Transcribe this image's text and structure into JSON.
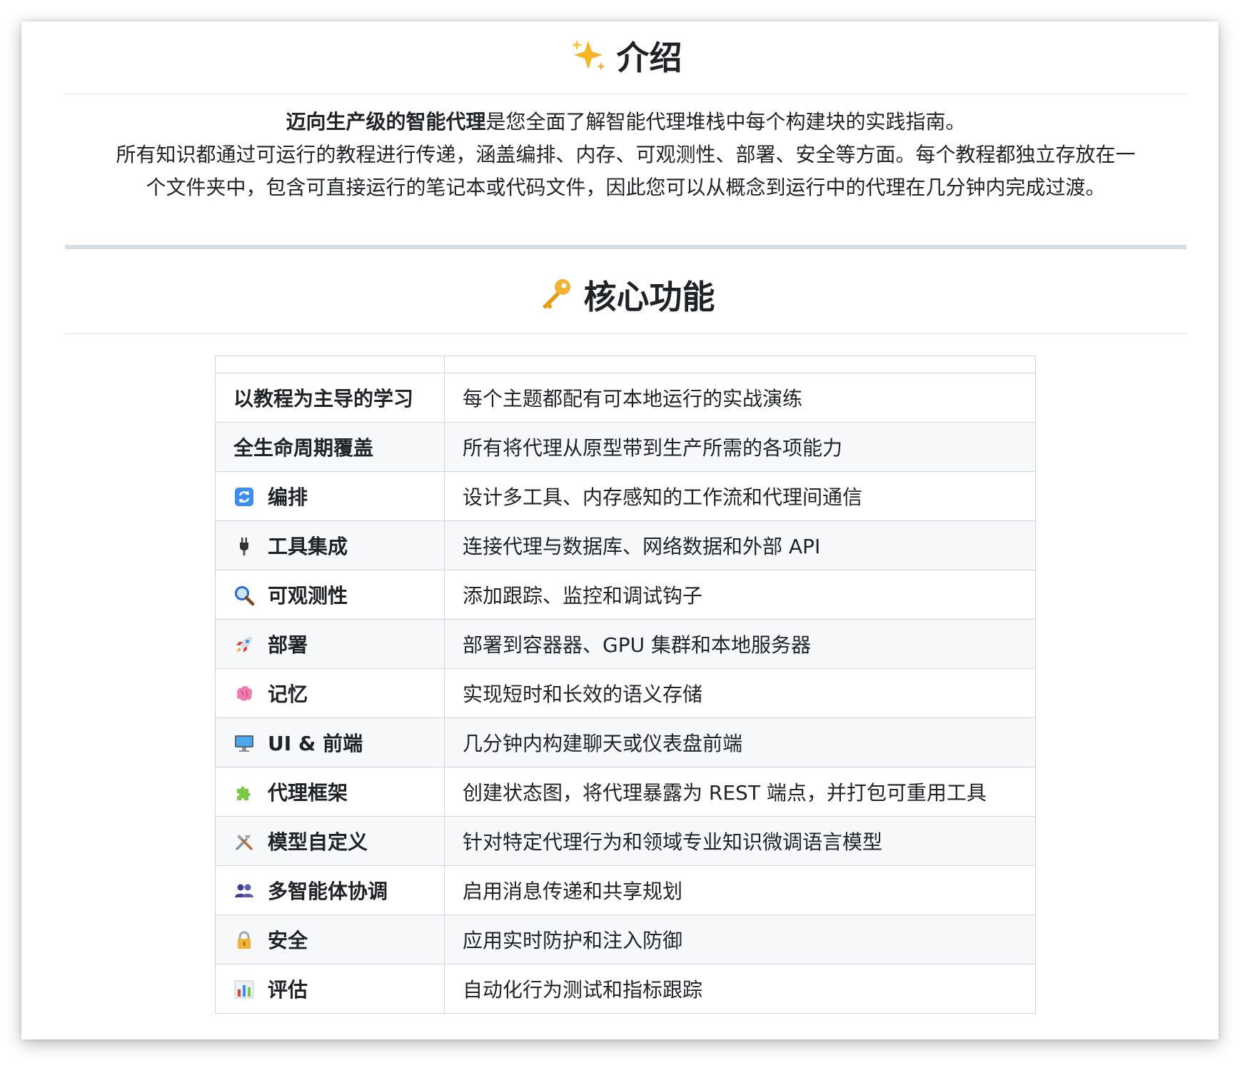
{
  "intro_section": {
    "title": "介绍",
    "icon": "sparkles-icon",
    "lead_bold": "迈向生产级的智能代理",
    "lead_rest": "是您全面了解智能代理堆栈中每个构建块的实践指南。",
    "line2": "所有知识都通过可运行的教程进行传递，涵盖编排、内存、可观测性、部署、安全等方面。每个教程都独立存放在一",
    "line3": "个文件夹中，包含可直接运行的笔记本或代码文件，因此您可以从概念到运行中的代理在几分钟内完成过渡。"
  },
  "features_section": {
    "title": "核心功能",
    "icon": "key-icon",
    "rows": [
      {
        "icon": "",
        "name": "以教程为主导的学习",
        "desc": "每个主题都配有可本地运行的实战演练"
      },
      {
        "icon": "",
        "name": "全生命周期覆盖",
        "desc": "所有将代理从原型带到生产所需的各项能力"
      },
      {
        "icon": "arrows-cycle-icon",
        "name": "编排",
        "desc": "设计多工具、内存感知的工作流和代理间通信"
      },
      {
        "icon": "plug-icon",
        "name": "工具集成",
        "desc": "连接代理与数据库、网络数据和外部 API"
      },
      {
        "icon": "magnifier-icon",
        "name": "可观测性",
        "desc": "添加跟踪、监控和调试钩子"
      },
      {
        "icon": "rocket-icon",
        "name": "部署",
        "desc": "部署到容器器、GPU 集群和本地服务器"
      },
      {
        "icon": "brain-icon",
        "name": "记忆",
        "desc": "实现短时和长效的语义存储"
      },
      {
        "icon": "monitor-icon",
        "name": "UI & 前端",
        "desc": "几分钟内构建聊天或仪表盘前端"
      },
      {
        "icon": "puzzle-icon",
        "name": "代理框架",
        "desc": "创建状态图，将代理暴露为 REST 端点，并打包可重用工具"
      },
      {
        "icon": "tools-icon",
        "name": "模型自定义",
        "desc": "针对特定代理行为和领域专业知识微调语言模型"
      },
      {
        "icon": "people-icon",
        "name": "多智能体协调",
        "desc": "启用消息传递和共享规划"
      },
      {
        "icon": "lock-icon",
        "name": "安全",
        "desc": "应用实时防护和注入防御"
      },
      {
        "icon": "bar-chart-icon",
        "name": "评估",
        "desc": "自动化行为测试和指标跟踪"
      }
    ]
  }
}
